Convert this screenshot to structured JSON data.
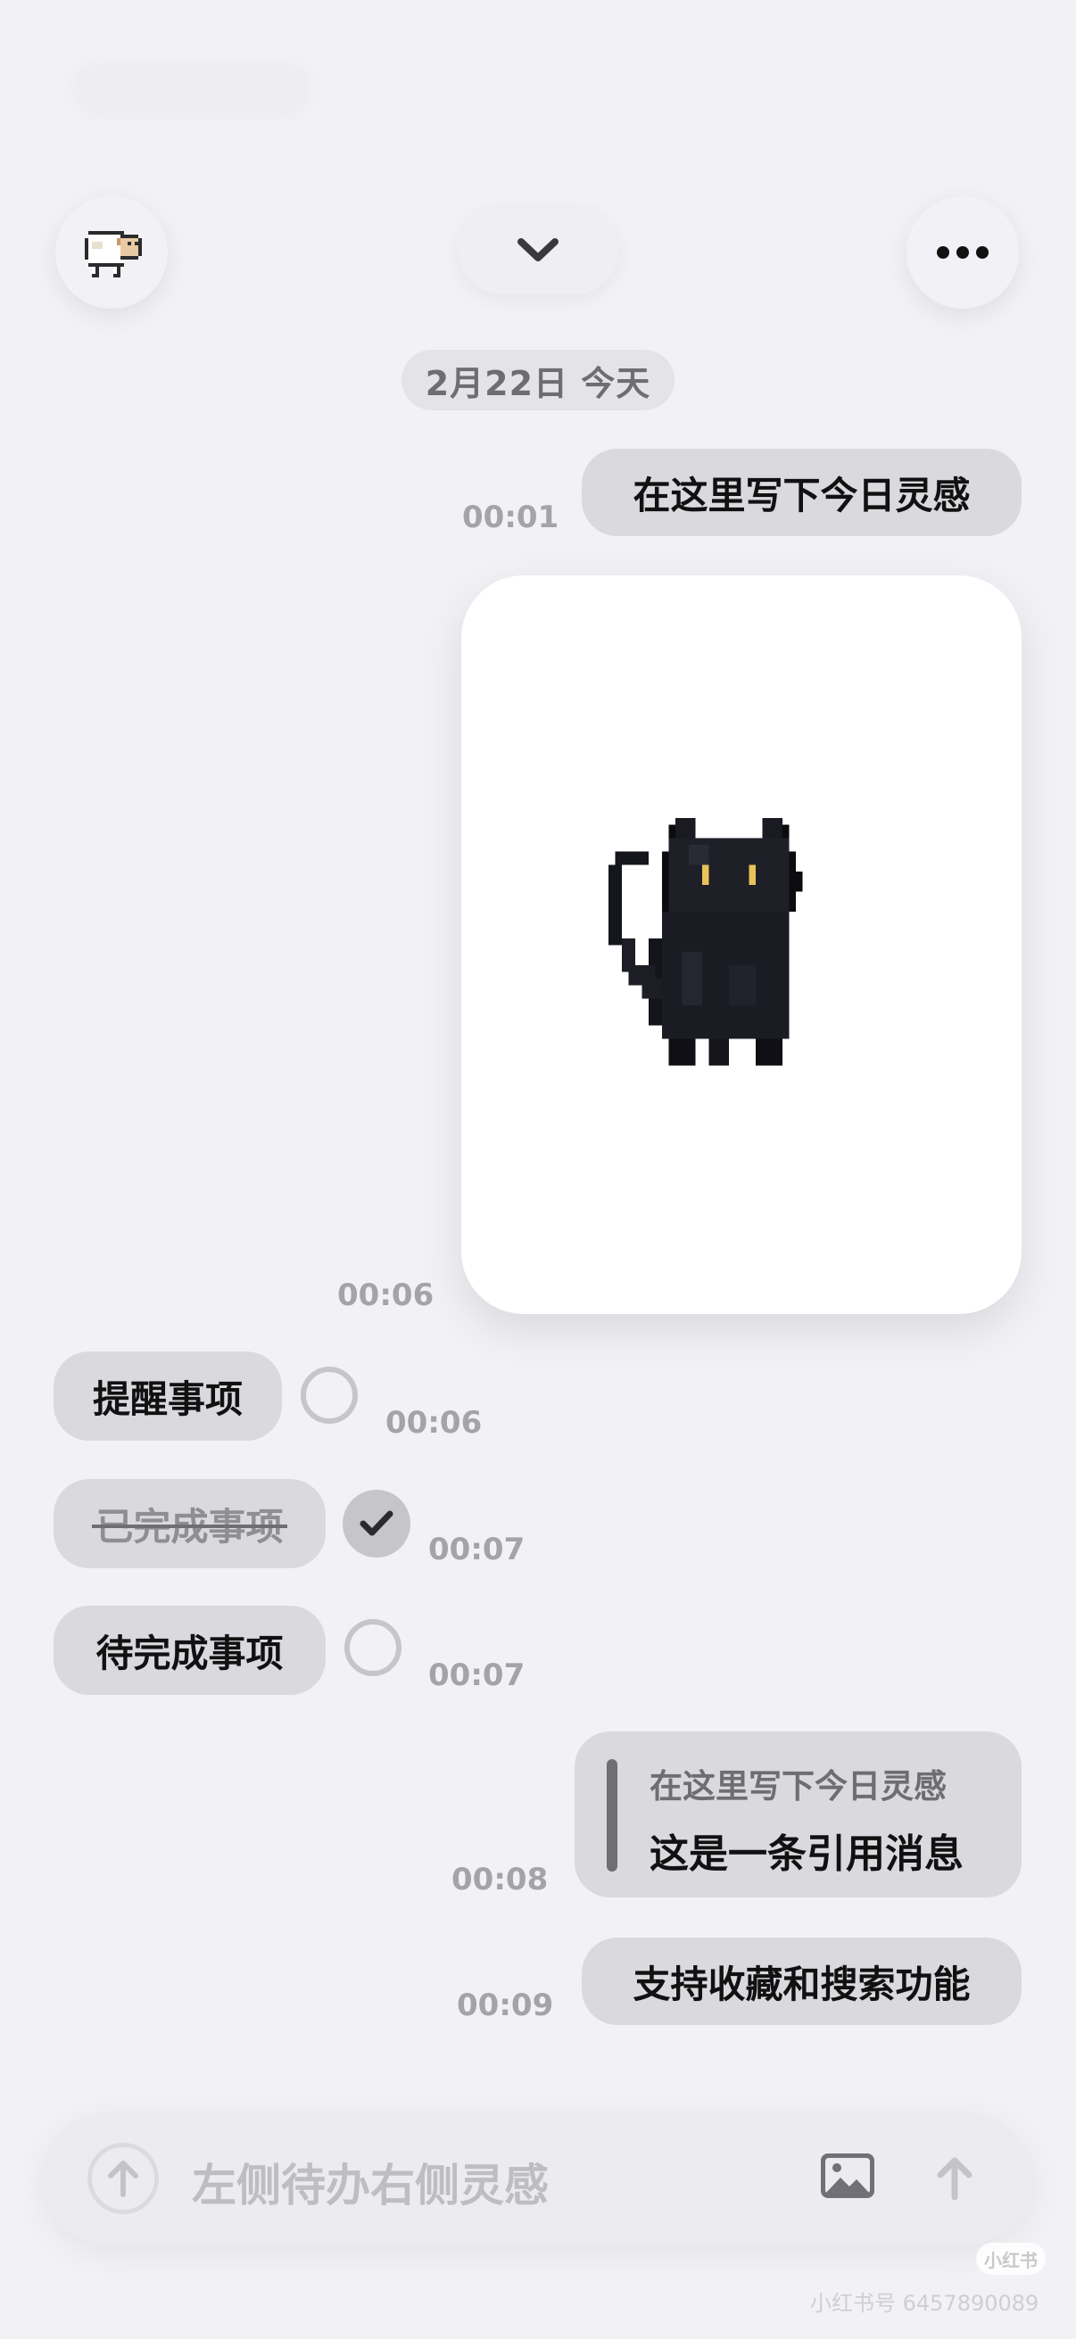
{
  "header": {
    "avatar_icon": "pixel-sheep-icon",
    "collapse_icon": "chevron-down-icon",
    "more_icon": "ellipsis-icon"
  },
  "date_label": "2月22日 今天",
  "messages": {
    "m1": {
      "text": "在这里写下今日灵感",
      "time": "00:01"
    },
    "image": {
      "time": "00:06",
      "icon": "pixel-black-cat-icon"
    },
    "todo1": {
      "text": "提醒事项",
      "time": "00:06",
      "done": false
    },
    "todo2": {
      "text": "已完成事项",
      "time": "00:07",
      "done": true
    },
    "todo3": {
      "text": "待完成事项",
      "time": "00:07",
      "done": false
    },
    "quote": {
      "quoted": "在这里写下今日灵感",
      "text": "这是一条引用消息",
      "time": "00:08"
    },
    "m2": {
      "text": "支持收藏和搜索功能",
      "time": "00:09"
    }
  },
  "input": {
    "placeholder": "左侧待办右侧灵感",
    "left_icon": "arrow-up-icon",
    "image_icon": "image-icon",
    "send_icon": "arrow-up-icon"
  },
  "watermark": {
    "logo": "小红书",
    "text": "小红书号 6457890089"
  },
  "colors": {
    "background": "#f2f2f6",
    "bubble": "#d9d9de",
    "timestamp": "#a3a3a8"
  }
}
